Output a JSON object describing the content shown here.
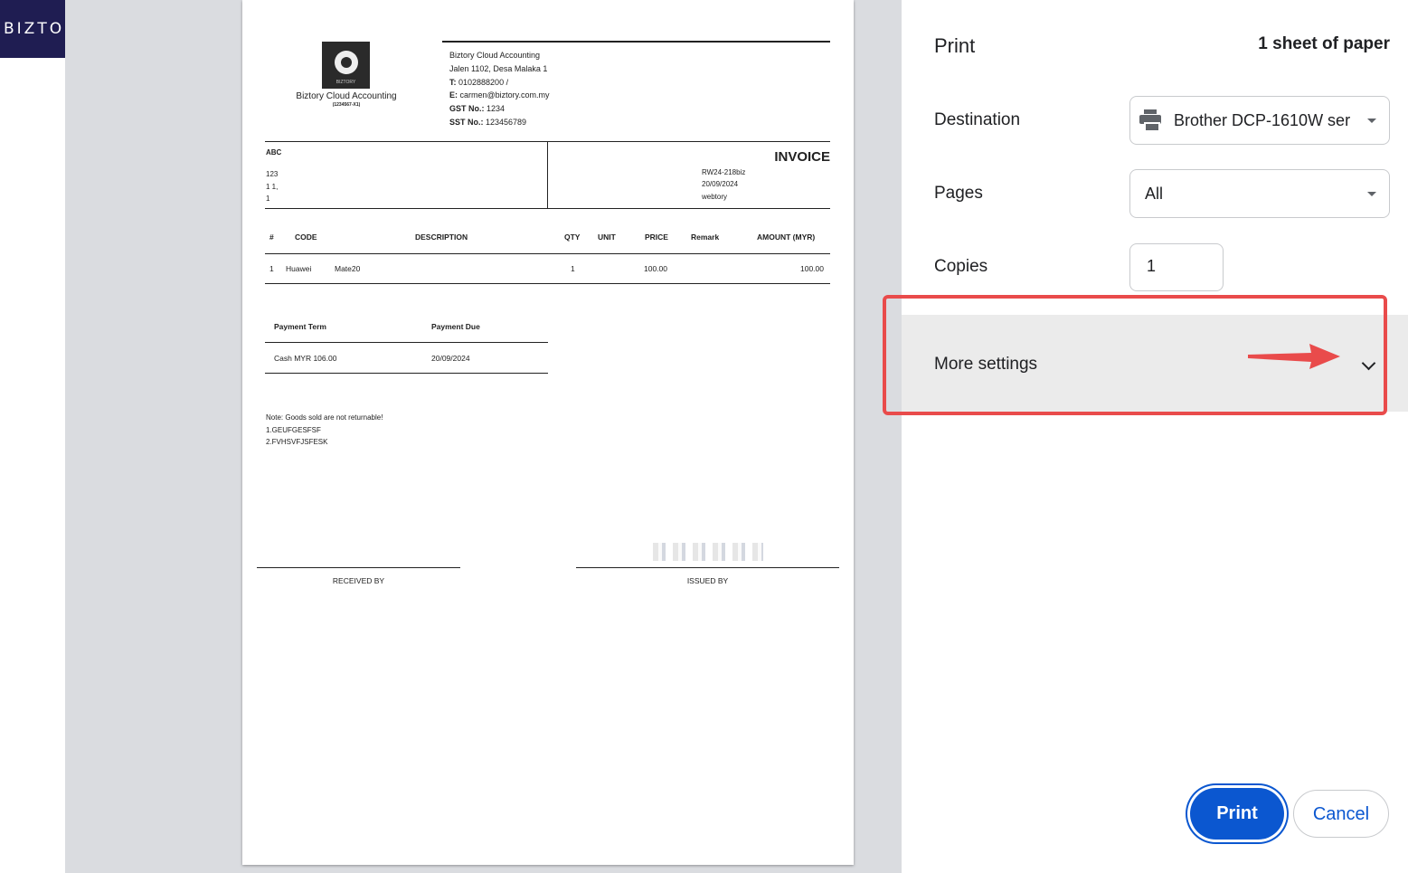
{
  "app": {
    "brand_text": "BIZTO"
  },
  "invoice": {
    "logo_text": "BIZTORY",
    "company_name": "Biztory Cloud Accounting",
    "company_reg": "(1234567-X1)",
    "address_lines": [
      "Biztory Cloud Accounting",
      "Jalen 1102, Desa Malaka 1"
    ],
    "tel_label": "T:",
    "tel": "0102888200 /",
    "email_label": "E:",
    "email": "carmen@biztory.com.my",
    "gst_label": "GST No.:",
    "gst": "1234",
    "sst_label": "SST No.:",
    "sst": "123456789",
    "bill_to_name": "ABC",
    "bill_to_lines": [
      "123",
      "1 1,",
      "1"
    ],
    "title": "INVOICE",
    "meta": [
      "RW24-218biz",
      "20/09/2024",
      "webtory"
    ],
    "columns": [
      "#",
      "CODE",
      "DESCRIPTION",
      "QTY",
      "UNIT",
      "PRICE",
      "Remark",
      "AMOUNT (MYR)"
    ],
    "items": [
      {
        "no": "1",
        "code": "Huawei",
        "description": "Mate20",
        "qty": "1",
        "unit": "",
        "price": "100.00",
        "remark": "",
        "amount": "100.00"
      }
    ],
    "payment_term_label": "Payment Term",
    "payment_due_label": "Payment Due",
    "payment_term": "Cash MYR 106.00",
    "payment_due": "20/09/2024",
    "notes": [
      "Note: Goods sold are not returnable!",
      "1.GEUFGESFSF",
      "2.FVHSVFJSFESK"
    ],
    "received_by": "RECEIVED BY",
    "issued_by": "ISSUED BY"
  },
  "print_panel": {
    "title": "Print",
    "sheets": "1 sheet of paper",
    "destination_label": "Destination",
    "destination_value": "Brother DCP-1610W ser",
    "destination_icon": "printer-icon",
    "pages_label": "Pages",
    "pages_value": "All",
    "copies_label": "Copies",
    "copies_value": "1",
    "more_settings_label": "More settings",
    "print_button": "Print",
    "cancel_button": "Cancel"
  },
  "colors": {
    "accent": "#0b57d0",
    "highlight": "#e94b4b",
    "brand": "#1f1d52"
  }
}
